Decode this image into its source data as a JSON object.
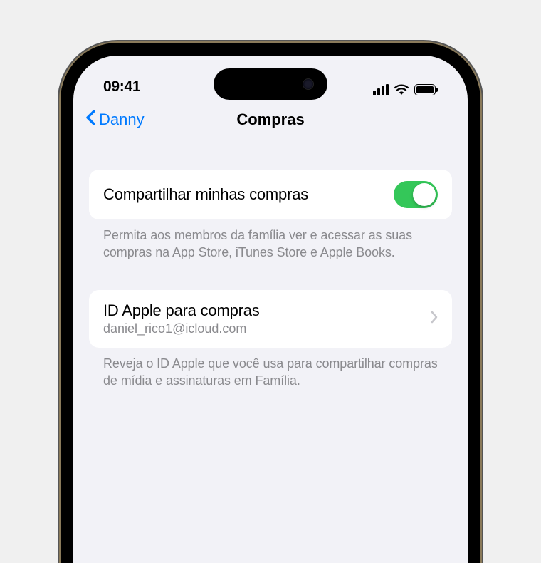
{
  "status_bar": {
    "time": "09:41"
  },
  "nav": {
    "back_label": "Danny",
    "title": "Compras"
  },
  "sections": [
    {
      "cell": {
        "label": "Compartilhar minhas compras",
        "toggle_on": true
      },
      "footer": "Permita aos membros da família ver e acessar as suas compras na App Store, iTunes Store e Apple Books."
    },
    {
      "cell": {
        "label": "ID Apple para compras",
        "sublabel": "daniel_rico1@icloud.com"
      },
      "footer": "Reveja o ID Apple que você usa para compartilhar compras de mídia e assinaturas em Família."
    }
  ],
  "colors": {
    "tint": "#007aff",
    "toggle_on": "#34c759",
    "background": "#f2f2f7",
    "secondary_text": "#8a8a8e"
  }
}
